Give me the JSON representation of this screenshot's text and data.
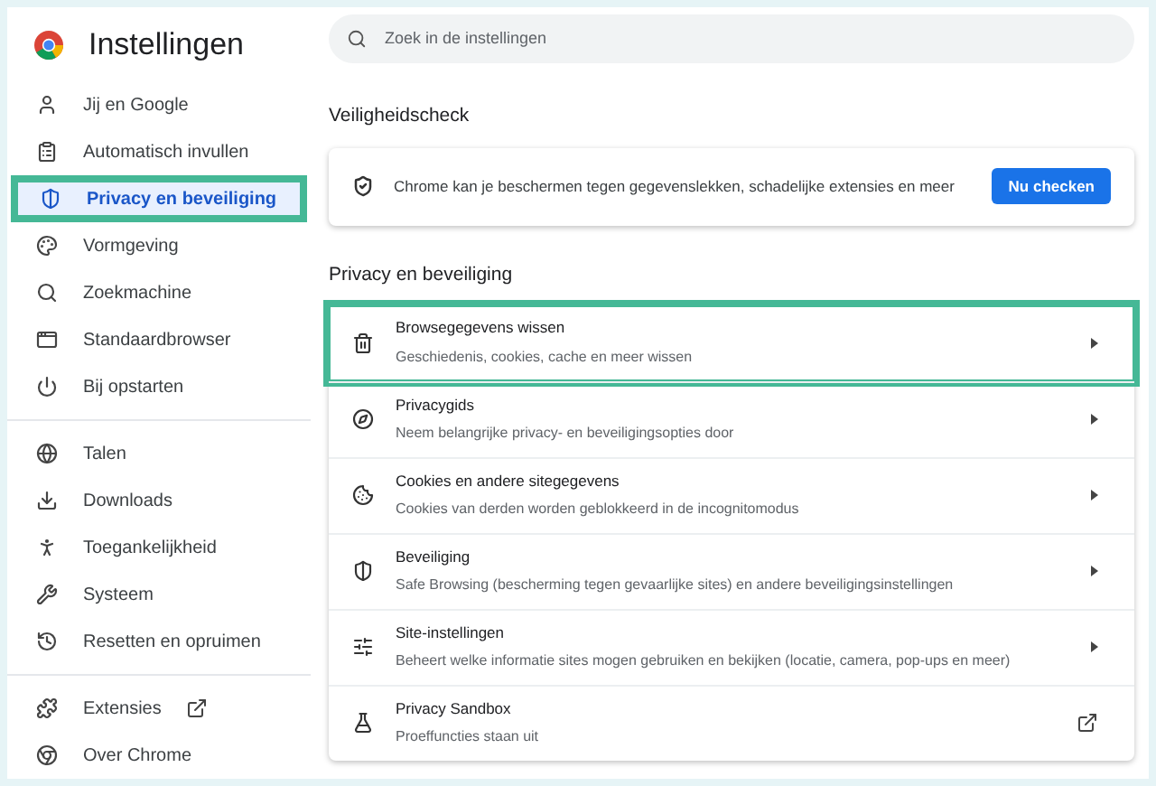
{
  "header": {
    "title": "Instellingen"
  },
  "search": {
    "placeholder": "Zoek in de instellingen"
  },
  "sidebar": {
    "groups": [
      [
        {
          "label": "Jij en Google",
          "selected": false,
          "highlighted": false
        },
        {
          "label": "Automatisch invullen",
          "selected": false,
          "highlighted": false
        },
        {
          "label": "Privacy en beveiliging",
          "selected": true,
          "highlighted": true
        },
        {
          "label": "Vormgeving",
          "selected": false,
          "highlighted": false
        },
        {
          "label": "Zoekmachine",
          "selected": false,
          "highlighted": false
        },
        {
          "label": "Standaardbrowser",
          "selected": false,
          "highlighted": false
        },
        {
          "label": "Bij opstarten",
          "selected": false,
          "highlighted": false
        }
      ],
      [
        {
          "label": "Talen",
          "selected": false,
          "highlighted": false
        },
        {
          "label": "Downloads",
          "selected": false,
          "highlighted": false
        },
        {
          "label": "Toegankelijkheid",
          "selected": false,
          "highlighted": false
        },
        {
          "label": "Systeem",
          "selected": false,
          "highlighted": false
        },
        {
          "label": "Resetten en opruimen",
          "selected": false,
          "highlighted": false
        }
      ],
      [
        {
          "label": "Extensies",
          "selected": false,
          "highlighted": false,
          "external": true
        },
        {
          "label": "Over Chrome",
          "selected": false,
          "highlighted": false,
          "external": false
        }
      ]
    ]
  },
  "safety_check": {
    "heading": "Veiligheidscheck",
    "text": "Chrome kan je beschermen tegen gegevenslekken, schadelijke extensies en meer",
    "button": "Nu checken"
  },
  "privacy": {
    "heading": "Privacy en beveiliging",
    "rows": [
      {
        "title": "Browsegegevens wissen",
        "subtitle": "Geschiedenis, cookies, cache en meer wissen",
        "kind": "arrow",
        "highlighted": true
      },
      {
        "title": "Privacygids",
        "subtitle": "Neem belangrijke privacy- en beveiligingsopties door",
        "kind": "arrow",
        "highlighted": false
      },
      {
        "title": "Cookies en andere sitegegevens",
        "subtitle": "Cookies van derden worden geblokkeerd in de incognitomodus",
        "kind": "arrow",
        "highlighted": false
      },
      {
        "title": "Beveiliging",
        "subtitle": "Safe Browsing (bescherming tegen gevaarlijke sites) en andere beveiligingsinstellingen",
        "kind": "arrow",
        "highlighted": false
      },
      {
        "title": "Site-instellingen",
        "subtitle": "Beheert welke informatie sites mogen gebruiken en bekijken (locatie, camera, pop-ups en meer)",
        "kind": "arrow",
        "highlighted": false
      },
      {
        "title": "Privacy Sandbox",
        "subtitle": "Proeffuncties staan uit",
        "kind": "external",
        "highlighted": false
      }
    ]
  }
}
